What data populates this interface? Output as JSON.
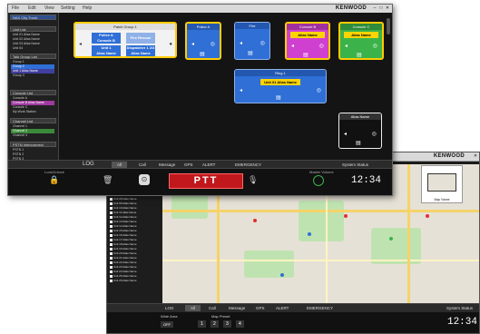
{
  "front": {
    "brand": "KENWOOD",
    "tabs": [
      "File",
      "Edit",
      "View",
      "Setting",
      "Help"
    ],
    "sidebar_top": "NAX City Trunk",
    "sidebar": [
      {
        "head": "Unit List",
        "items": [
          "Unit 01 Alias Name",
          "Unit 02 Alias Name",
          "Unit 03 Alias Name",
          "Unit 04"
        ]
      },
      {
        "head": "Talk Group List",
        "items": [
          "Group 1",
          "Group 2",
          "Unit 1 Alias Name",
          "Group 3"
        ]
      },
      {
        "head": "Console List",
        "items": [
          "Console A",
          "Console B Alias Name",
          "Console C",
          "My Work Station"
        ]
      },
      {
        "head": "Channel List",
        "items": [
          "Channel 1",
          "Channel 2",
          "Channel 3"
        ]
      },
      {
        "head": "PSTN Interconnect",
        "items": [
          "PSTN 1",
          "PSTN 2",
          "PSTN 3",
          "PSTN 4",
          "PSTN 5"
        ]
      }
    ],
    "patch": {
      "title": "Patch Group 1",
      "a": "Police A\nConsole B",
      "b": "Fire Rescue",
      "c": "Unit 1\nAlias Name",
      "d": "Dispatcher 1 2/3\nAlias Name"
    },
    "cards": [
      {
        "title": "Police A",
        "badge": "",
        "color": "#2f6fd6",
        "ring": "#ffcc00"
      },
      {
        "title": "Fire",
        "badge": "",
        "color": "#2f6fd6",
        "ring": "#2f6fd6"
      },
      {
        "title": "Console B",
        "badge": "Alias Name",
        "color": "#d040d0",
        "ring": "#ffcc00"
      },
      {
        "title": "Console C",
        "badge": "Alias Name",
        "color": "#3bb34a",
        "ring": "#ffcc00"
      },
      {
        "title": "Ring 1",
        "badge": "Unit 01 Alias Name",
        "color": "#2f6fd6",
        "ring": "#2f6fd6"
      },
      {
        "title": "Alias Name",
        "badge": "",
        "color": "#111111",
        "ring": "#eeeeee"
      }
    ],
    "bottom_tabs": [
      "LOG",
      "All",
      "Call",
      "Message",
      "GPS",
      "ALERT",
      "EMERGENCY",
      "System Status"
    ],
    "ptt": "PTT",
    "clock": "12:34",
    "lock_label": "Lock/Unlock",
    "master_volume": "Master Volume"
  },
  "back": {
    "brand": "KENWOOD",
    "units": [
      "Unit 01 Alias Name",
      "Unit 02 Alias Name",
      "Unit 03 Alias Name",
      "Unit 04 Alias Name",
      "Unit 05 Alias Name",
      "Unit 06 Alias Name",
      "Unit 07 Alias Name",
      "Unit 08 Alias Name",
      "Unit 09 Alias Name",
      "Unit 10 Alias Name",
      "Unit 11 Alias Name",
      "Unit 12 Alias Name",
      "Unit 13 Alias Name",
      "Unit 14 Alias Name",
      "Unit 15 Alias Name",
      "Unit 16 Alias Name",
      "Unit 17 Alias Name",
      "Unit 18 Alias Name",
      "Unit 19 Alias Name",
      "Unit 20 Alias Name",
      "Unit 21 Alias Name",
      "Unit 22 Alias Name",
      "Unit 23 Alias Name",
      "Unit 24 Alias Name",
      "Unit 25 Alias Name",
      "Unit 26 Alias Name"
    ],
    "bottom_tabs": [
      "LOG",
      "All",
      "Call",
      "Message",
      "GPS",
      "ALERT",
      "EMERGENCY",
      "System Status"
    ],
    "wide_area": "Wide Area",
    "map_preset": "Map Preset",
    "presets": [
      "1",
      "2",
      "3",
      "4"
    ],
    "off": "OFF",
    "map_name": "Map Name",
    "clock": "12:34"
  }
}
